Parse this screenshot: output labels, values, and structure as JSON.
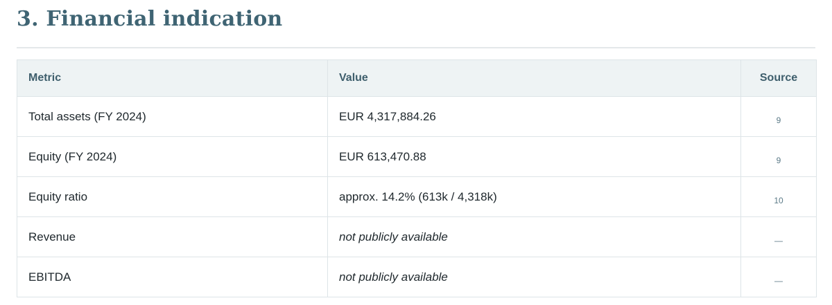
{
  "section": {
    "title": "3. Financial indication"
  },
  "table": {
    "headers": {
      "metric": "Metric",
      "value": "Value",
      "source": "Source"
    },
    "rows": [
      {
        "metric": "Total assets (FY 2024)",
        "value": "EUR 4,317,884.26",
        "source": "9",
        "unavailable": false
      },
      {
        "metric": "Equity (FY 2024)",
        "value": "EUR 613,470.88",
        "source": "9",
        "unavailable": false
      },
      {
        "metric": "Equity ratio",
        "value": "approx. 14.2% (613k / 4,318k)",
        "source": "10",
        "unavailable": false
      },
      {
        "metric": "Revenue",
        "value": "not publicly available",
        "source": "—",
        "unavailable": true
      },
      {
        "metric": "EBITDA",
        "value": "not publicly available",
        "source": "—",
        "unavailable": true
      }
    ]
  },
  "colors": {
    "title": "#3f6473",
    "header_bg": "#eef3f4",
    "header_text": "#3e5e6c",
    "unavailable_text": "#b97440",
    "source_link": "#5b7a87",
    "border": "#dde4e7"
  }
}
